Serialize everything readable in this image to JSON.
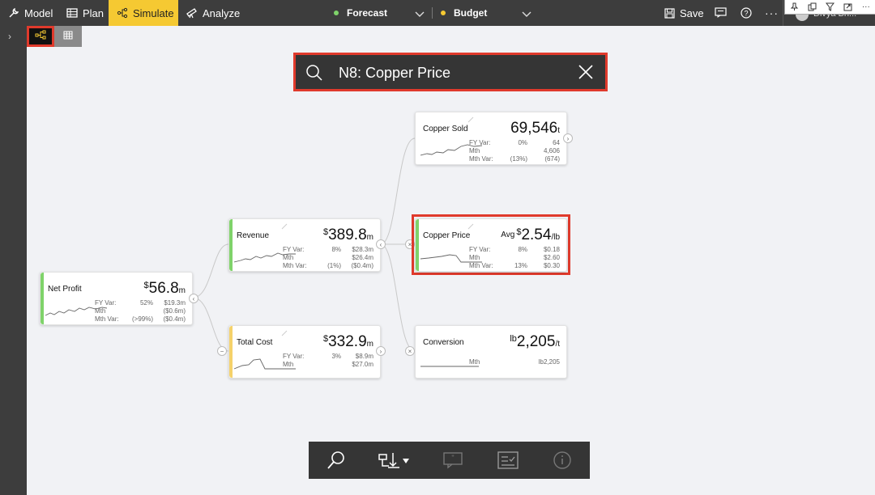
{
  "topbar": {
    "model_label": "Model",
    "plan_label": "Plan",
    "simulate_label": "Simulate",
    "analyze_label": "Analyze",
    "scenario1": {
      "label": "Forecast",
      "color": "#7fd36a"
    },
    "scenario2": {
      "label": "Budget",
      "color": "#f5c932"
    },
    "save_label": "Save",
    "user_name": "Divya Bh..."
  },
  "search": {
    "value": "N8: Copper Price"
  },
  "nodes": {
    "net_profit": {
      "title": "Net Profit",
      "currency": "$",
      "value": "56.8",
      "unit": "m",
      "accent": "#7fd36a",
      "stats": [
        {
          "label": "FY Var:",
          "c1": "52%",
          "c2": "$19.3m"
        },
        {
          "label": "Mth",
          "c1": "",
          "c2": "($0.6m)"
        },
        {
          "label": "Mth Var:",
          "c1": "(>99%)",
          "c2": "($0.4m)"
        }
      ]
    },
    "revenue": {
      "title": "Revenue",
      "currency": "$",
      "value": "389.8",
      "unit": "m",
      "accent": "#7fd36a",
      "stats": [
        {
          "label": "FY Var:",
          "c1": "8%",
          "c2": "$28.3m"
        },
        {
          "label": "Mth",
          "c1": "",
          "c2": "$26.4m"
        },
        {
          "label": "Mth Var:",
          "c1": "(1%)",
          "c2": "($0.4m)"
        }
      ]
    },
    "total_cost": {
      "title": "Total Cost",
      "currency": "$",
      "value": "332.9",
      "unit": "m",
      "accent": "#f5d26a",
      "stats": [
        {
          "label": "FY Var:",
          "c1": "3%",
          "c2": "$8.9m"
        },
        {
          "label": "Mth",
          "c1": "",
          "c2": "$27.0m"
        }
      ]
    },
    "copper_sold": {
      "title": "Copper Sold",
      "currency": "",
      "value": "69,546",
      "unit": "t",
      "accent": "",
      "stats": [
        {
          "label": "FY Var:",
          "c1": "0%",
          "c2": "64"
        },
        {
          "label": "Mth",
          "c1": "",
          "c2": "4,606"
        },
        {
          "label": "Mth Var:",
          "c1": "(13%)",
          "c2": "(674)"
        }
      ]
    },
    "copper_price": {
      "title": "Copper Price",
      "prefix": "Avg",
      "currency": "$",
      "value": "2.54",
      "unit": "/lb",
      "accent": "#7fd36a",
      "stats": [
        {
          "label": "FY Var:",
          "c1": "8%",
          "c2": "$0.18"
        },
        {
          "label": "Mth",
          "c1": "",
          "c2": "$2.60"
        },
        {
          "label": "Mth Var:",
          "c1": "13%",
          "c2": "$0.30"
        }
      ]
    },
    "conversion": {
      "title": "Conversion",
      "currency": "lb",
      "value": "2,205",
      "unit": "/t",
      "accent": "",
      "stats": [
        {
          "label": "Mth",
          "c1": "",
          "c2": "lb2,205"
        }
      ]
    }
  },
  "colors": {
    "accent_red": "#e03a2c",
    "toolbar_dark": "#353535",
    "simulate_yellow": "#f5c932"
  },
  "icons": {
    "topbar": [
      "wrench-icon",
      "table-icon",
      "simulate-icon",
      "telescope-icon",
      "chevron-down-icon",
      "save-icon",
      "comment-icon",
      "help-icon",
      "more-icon"
    ],
    "bottombar": [
      "search-icon",
      "sort-down-icon",
      "comment-icon",
      "checklist-icon",
      "info-icon"
    ]
  }
}
